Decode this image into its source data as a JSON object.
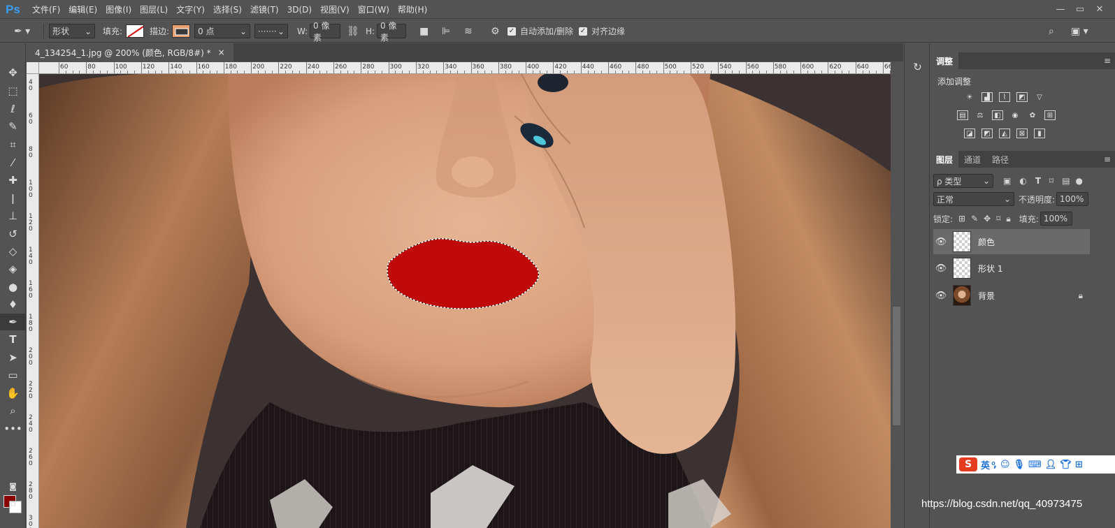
{
  "app": {
    "logo": "Ps"
  },
  "menu": [
    "文件(F)",
    "编辑(E)",
    "图像(I)",
    "图层(L)",
    "文字(Y)",
    "选择(S)",
    "滤镜(T)",
    "3D(D)",
    "视图(V)",
    "窗口(W)",
    "帮助(H)"
  ],
  "window_controls": [
    "—",
    "▭",
    "✕"
  ],
  "options": {
    "tool_mode": "形状",
    "fill_label": "填充:",
    "stroke_label": "描边:",
    "stroke_width": "0 点",
    "w_label": "W:",
    "w_value": "0 像素",
    "h_label": "H:",
    "h_value": "0 像素",
    "auto_add_delete": "自动添加/删除",
    "align_edges": "对齐边缘"
  },
  "document": {
    "tab_title": "4_134254_1.jpg @ 200% (颜色, RGB/8#) *",
    "close": "×"
  },
  "ruler": {
    "h_ticks": [
      "60",
      "80",
      "100",
      "120",
      "140",
      "160",
      "180",
      "200",
      "220",
      "240",
      "260",
      "280",
      "300",
      "320",
      "340",
      "360",
      "380",
      "400",
      "420",
      "440",
      "460",
      "480",
      "500",
      "520",
      "540",
      "560",
      "580",
      "600",
      "620",
      "640",
      "66"
    ],
    "v_ticks": [
      "40",
      "60",
      "80",
      "100",
      "120",
      "140",
      "160",
      "180",
      "200",
      "220",
      "240",
      "260",
      "280",
      "300"
    ]
  },
  "adjustments": {
    "tab": "调整",
    "title": "添加调整"
  },
  "layers_panel": {
    "tabs": [
      "图层",
      "通道",
      "路径"
    ],
    "filter_label": "ρ 类型",
    "blend_mode": "正常",
    "opacity_label": "不透明度:",
    "opacity_value": "100%",
    "lock_label": "锁定:",
    "fill_label": "填充:",
    "fill_value": "100%",
    "layers": [
      {
        "name": "颜色",
        "selected": true
      },
      {
        "name": "形状 1",
        "selected": false
      },
      {
        "name": "背景",
        "selected": false
      }
    ]
  },
  "ime": {
    "logo": "S",
    "lang": "英"
  },
  "watermark": "https://blog.csdn.net/qq_40973475",
  "colors": {
    "foreground": "#8b0000",
    "background": "#ffffff",
    "lip_fill": "#c00a0a"
  }
}
